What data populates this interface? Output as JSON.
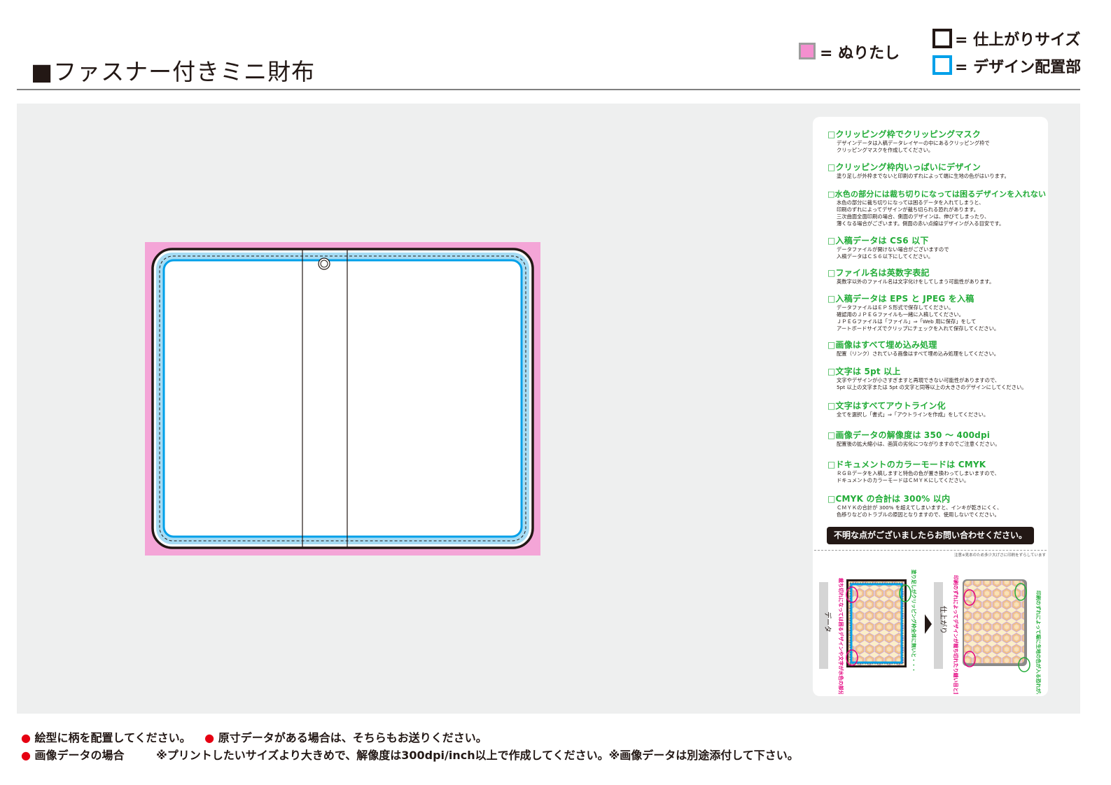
{
  "header": {
    "title": "■ファスナー付きミニ財布"
  },
  "legend": {
    "bleed_label": "= ぬりたし",
    "finish_label": "= 仕上がりサイズ",
    "design_label": "= デザイン配置部",
    "colors": {
      "bleed": "#f48fcf",
      "finish": "#231815",
      "design": "#00a0e9"
    }
  },
  "checklist": [
    {
      "heading": "□クリッピング枠でクリッピングマスク",
      "desc": "デザインデータは入稿データレイヤーの中にあるクリッピング枠で\nクリッピングマスクを作成してください。"
    },
    {
      "heading": "□クリッピング枠内いっぱいにデザイン",
      "desc": "塗り足しが外枠までないと印刷のずれによって端に生地の色がはいります。"
    },
    {
      "heading": "□水色の部分には裁ち切りになっては困るデザインを入れない",
      "desc": "水色の部分に裁ち切りになっては困るデータを入れてしまうと、\n印刷のずれによってデザインが裁ち切られる恐れがあります。\n三次曲面全面印刷の場合、側面のデザインは、伸びてしまったり、\n薄くなる場合がございます。側面の赤い点線はデザインが入る目安です。"
    },
    {
      "heading": "□入稿データは CS6 以下",
      "desc": "データファイルが開けない場合がございますので\n入稿データはＣＳ６以下にしてください。"
    },
    {
      "heading": "□ファイル名は英数字表記",
      "desc": "英数字以外のファイル名は文字化けをしてしまう可能性があります。"
    },
    {
      "heading": "□入稿データは EPS と JPEG を入稿",
      "desc": "データファイルはＥＰＳ形式で保存してください。\n確認用のＪＰＥＧファイルも一緒に入稿してください。\nＪＰＥＧファイルは「ファイル」⇒「Web 用に保存」をして\nアートボードサイズでクリップにチェックを入れて保存してください。"
    },
    {
      "heading": "□画像はすべて埋め込み処理",
      "desc": "配置（リンク）されている画像はすべて埋め込み処理をしてください。"
    },
    {
      "heading": "□文字は 5pt 以上",
      "desc": "文字やデザインが小さすぎますと再現できない可能性がありますので、\n5pt 以上の文字または 5pt の文字と同等以上の大きさのデザインにしてください。"
    },
    {
      "heading": "□文字はすべてアウトライン化",
      "desc": "全てを選択し「書式」⇒「アウトラインを作成」をしてください。"
    },
    {
      "heading": "□画像データの解像度は 350 ～ 400dpi",
      "desc": "配置後の拡大縮小は、画質の劣化につながりますのでご注意ください。"
    },
    {
      "heading": "□ドキュメントのカラーモードは CMYK",
      "desc": "ＲＧＢデータを入稿しますと特色の色が置き換わってしまいますので、\nドキュメントのカラーモードはＣＭＹＫにしてください。"
    },
    {
      "heading": "□CMYK の合計は 300% 以内",
      "desc": "ＣＭＹＫの合計が 300% を超えてしまいますと、インキが乾きにくく、\n色移りなどのトラブルの原因となりますので、使用しないでください。"
    }
  ],
  "contact": "不明な点がございましたらお問い合わせください。",
  "example": {
    "note": "注意※見本のため多少大げさに印刷をずらしています",
    "data_label": "データ",
    "finish_label": "仕上がり",
    "left_note_magenta": "裁ち切れになっては困るデザインや文字が水色の部分に入っていると・・・",
    "left_note_green": "塗り足しがクリッピング枠全体に無いと・・・",
    "right_note_magenta": "印刷のずれによってデザインが裁ち切れたり縫い目と重なってしまう恐れがあります",
    "right_note_green": "印刷のずれによって端に生地の色が入る恐れがあります"
  },
  "footer": {
    "bullet": "●",
    "line1_a": "絵型に柄を配置してください。",
    "line1_b": "原寸データがある場合は、そちらもお送りください。",
    "line2_a": "画像データの場合",
    "line2_b": "※プリントしたいサイズより大きめで、解像度は300dpi/inch以上で作成してください。※画像データは別途添付して下さい。"
  }
}
